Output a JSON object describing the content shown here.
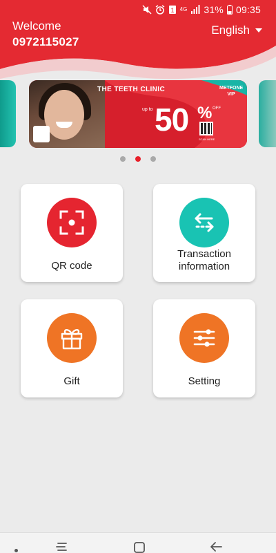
{
  "status_bar": {
    "battery_percent": "31%",
    "time": "09:35",
    "network_type": "4G",
    "sim_badge": "1",
    "icons": [
      "mute-icon",
      "alarm-icon",
      "sim-icon",
      "network-4g-icon",
      "signal-icon",
      "battery-icon"
    ]
  },
  "header": {
    "greeting": "Welcome",
    "phone_number": "0972115027",
    "language": "English"
  },
  "carousel": {
    "active_index": 1,
    "slide_count": 3,
    "banner": {
      "clinic": "THE TEETH CLINIC",
      "tag": "METFONE VIP",
      "prefix": "up to",
      "discount": "50",
      "percent": "%",
      "suffix": "OFF",
      "qr_caption": "SCAN HERE"
    }
  },
  "menu": {
    "qr": {
      "label": "QR code",
      "icon": "qr-scan-icon",
      "color": "#e52530"
    },
    "transaction": {
      "label_line1": "Transaction",
      "label_line2": "information",
      "icon": "transfer-arrows-icon",
      "color": "#19c3b3"
    },
    "gift": {
      "label": "Gift",
      "icon": "gift-icon",
      "color": "#ef7425"
    },
    "setting": {
      "label": "Setting",
      "icon": "sliders-icon",
      "color": "#ef7425"
    }
  },
  "navigation": {
    "buttons": [
      "recent-apps-icon",
      "home-icon",
      "back-icon"
    ]
  },
  "colors": {
    "brand_red": "#e52530",
    "teal": "#19c3b3",
    "orange": "#ef7425",
    "background": "#ebebeb"
  }
}
